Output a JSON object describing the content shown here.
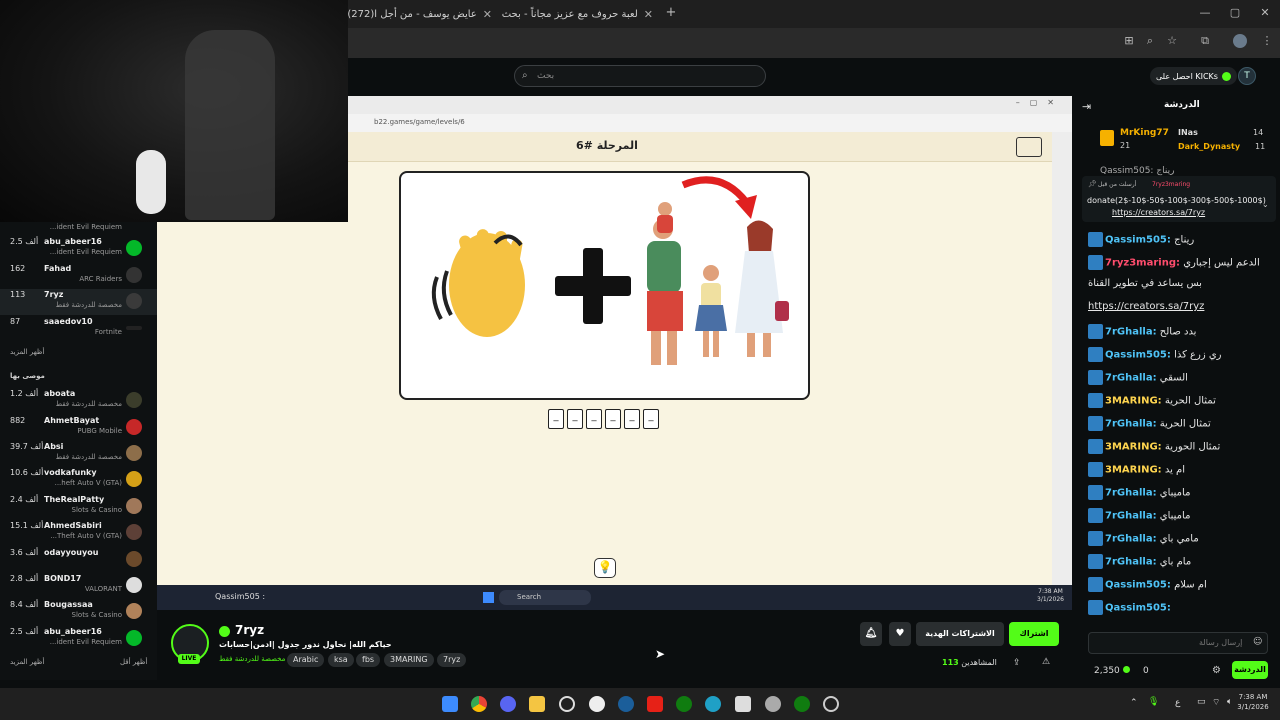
{
  "browser": {
    "tabs": [
      {
        "label": "عايض يوسف - من أجل ا(272)"
      },
      {
        "label": "لعبة حروف مع عزيز مجاناً - بحث"
      }
    ]
  },
  "kick": {
    "search_placeholder": "بحث",
    "kicks_label": "احصل على KICKs"
  },
  "sidebar": {
    "channels_top": [
      {
        "views": "",
        "name": "",
        "game": "...ident Evil Requiem"
      },
      {
        "views": "2.5 ألف",
        "name": "abu_abeer16",
        "game": "...ident Evil Requiem"
      },
      {
        "views": "162",
        "name": "Fahad",
        "game": "ARC Raiders"
      },
      {
        "views": "113",
        "name": "7ryz",
        "game": "مخصصة للدردشة فقط"
      },
      {
        "views": "87",
        "name": "saaedov10",
        "game": "Fortnite"
      }
    ],
    "show_more": "أظهر المزيد",
    "recommended_title": "موصى بها",
    "recommended": [
      {
        "views": "1.2 ألف",
        "name": "aboata",
        "game": "مخصصة للدردشة فقط"
      },
      {
        "views": "882",
        "name": "AhmetBayat",
        "game": "PUBG Mobile"
      },
      {
        "views": "39.7 ألف",
        "name": "Absi",
        "game": "مخصصة للدردشة فقط"
      },
      {
        "views": "10.6 ألف",
        "name": "vodkafunky",
        "game": "...heft Auto V (GTA)"
      },
      {
        "views": "2.4 ألف",
        "name": "TheRealPatty",
        "game": "Slots & Casino"
      },
      {
        "views": "15.1 ألف",
        "name": "AhmedSabiri",
        "game": "...Theft Auto V (GTA)"
      },
      {
        "views": "3.6 ألف",
        "name": "odayyouyou",
        "game": ""
      },
      {
        "views": "2.8 ألف",
        "name": "BOND17",
        "game": "VALORANT"
      },
      {
        "views": "8.4 ألف",
        "name": "Bougassaa",
        "game": "Slots & Casino"
      },
      {
        "views": "2.5 ألف",
        "name": "abu_abeer16",
        "game": "...ident Evil Requiem"
      }
    ],
    "show_more_bottom": "أظهر المزيد",
    "show_less": "أظهر أقل"
  },
  "stream": {
    "inner_url": "b22.games/game/levels/6",
    "level_title": "المرحلة #6",
    "overlay_user": "Qassim505 :",
    "slots": [
      "_",
      "_",
      "_",
      "_",
      "_",
      "_"
    ],
    "hint_icon": "lightbulb-icon",
    "inner_taskbar": {
      "search": "Search",
      "time": "7:38 AM",
      "date": "3/1/2026"
    }
  },
  "streamer": {
    "name": "7ryz",
    "title": "حياكم الله| نحاول ندور جدول |ادمن|حسابات",
    "category": "مخصصة للدردشة فقط",
    "tags": [
      "Arabic",
      "ksa",
      "fbs",
      "3MARING",
      "7ryz"
    ],
    "live_label": "LIVE",
    "viewers": "113",
    "viewers_label": "المشاهدين",
    "subscribe_label": "اشتراك",
    "gift_label": "الاشتراكات الهدية"
  },
  "chat": {
    "title": "الدردشة",
    "leaderboard": [
      {
        "name": "MrKing77",
        "count": "21"
      },
      {
        "name": "INas",
        "count": "14"
      },
      {
        "name": "Dark_Dynasty",
        "count": "11"
      }
    ],
    "pinned": {
      "by": "أرسلت من قبل",
      "pinned_user": "7ryz3maring",
      "text": "donate(2$-10$-50$-100$-300$-500$-1000$)",
      "link": "https://creators.sa/7ryz"
    },
    "partial_top": "Qassim505: ريناج",
    "messages": [
      {
        "user": "Qassim505:",
        "text": "ريناج",
        "color": "#4fc3f7"
      },
      {
        "user": "7ryz3maring:",
        "text": "الدعم ليس إجباري",
        "color": "#ff4d6d"
      },
      {
        "user": "",
        "text": "بس يساعد في تطوير القناة",
        "color": "#e6e6e6"
      },
      {
        "user": "",
        "text": "https://creators.sa/7ryz",
        "color": "#e6e6e6"
      },
      {
        "user": "7rGhalla:",
        "text": "بدد صالح",
        "color": "#4fc3f7"
      },
      {
        "user": "Qassim505:",
        "text": "ري زرع كذا",
        "color": "#4fc3f7"
      },
      {
        "user": "7rGhalla:",
        "text": "السقي",
        "color": "#4fc3f7"
      },
      {
        "user": "3MARING:",
        "text": "تمثال الحرية",
        "color": "#ffd54f"
      },
      {
        "user": "7rGhalla:",
        "text": "تمثال الحرية",
        "color": "#4fc3f7"
      },
      {
        "user": "3MARING:",
        "text": "تمثال الحورية",
        "color": "#ffd54f"
      },
      {
        "user": "3MARING:",
        "text": "ام يد",
        "color": "#ffd54f"
      },
      {
        "user": "7rGhalla:",
        "text": "ماميباي",
        "color": "#4fc3f7"
      },
      {
        "user": "7rGhalla:",
        "text": "ماميباي",
        "color": "#4fc3f7"
      },
      {
        "user": "7rGhalla:",
        "text": "مامي باي",
        "color": "#4fc3f7"
      },
      {
        "user": "7rGhalla:",
        "text": "مام باي",
        "color": "#4fc3f7"
      },
      {
        "user": "Qassim505:",
        "text": "ام سلام",
        "color": "#4fc3f7"
      },
      {
        "user": "Qassim505:",
        "text": "",
        "color": "#4fc3f7"
      }
    ],
    "input_placeholder": "إرسال رسالة",
    "kicks_balance": "2,350",
    "zero": "0",
    "chat_button": "الدردشة"
  },
  "taskbar": {
    "time": "7:38 AM",
    "date": "3/1/2026",
    "lang": "ع"
  },
  "colors": {
    "kick_green": "#53fc18",
    "stream_bg": "#f9f4e1"
  }
}
